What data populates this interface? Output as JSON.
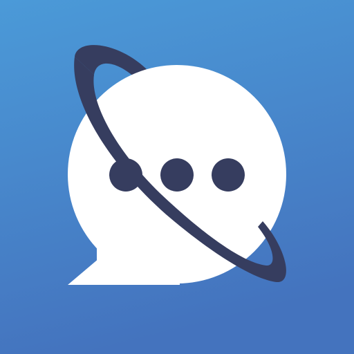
{
  "icon": {
    "name": "chat-orbit-app-icon",
    "background_gradient": [
      "#4B9AD8",
      "#4473BE"
    ],
    "bubble_color": "#FFFFFF",
    "accent_color": "#363D5F",
    "dot_count": 3
  }
}
